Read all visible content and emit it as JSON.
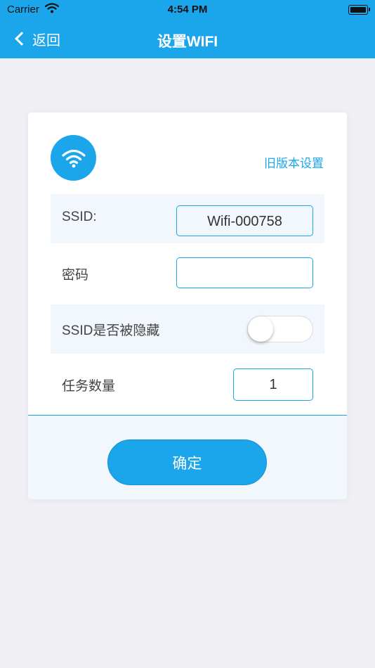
{
  "status_bar": {
    "carrier": "Carrier",
    "time": "4:54 PM"
  },
  "nav": {
    "back_label": "返回",
    "title": "设置WIFI"
  },
  "card": {
    "old_settings_link": "旧版本设置",
    "ssid": {
      "label": "SSID:",
      "value": "Wifi-000758"
    },
    "password": {
      "label": "密码",
      "value": ""
    },
    "hidden": {
      "label": "SSID是否被隐藏",
      "on": false
    },
    "task_count": {
      "label": "任务数量",
      "value": "1"
    },
    "confirm_label": "确定"
  },
  "colors": {
    "accent": "#1ba6ec",
    "background": "#efeff4",
    "row_shade": "#f1f7fc"
  },
  "icons": [
    "wifi-signal-icon",
    "battery-icon",
    "back-chevron-icon",
    "wifi-icon"
  ]
}
